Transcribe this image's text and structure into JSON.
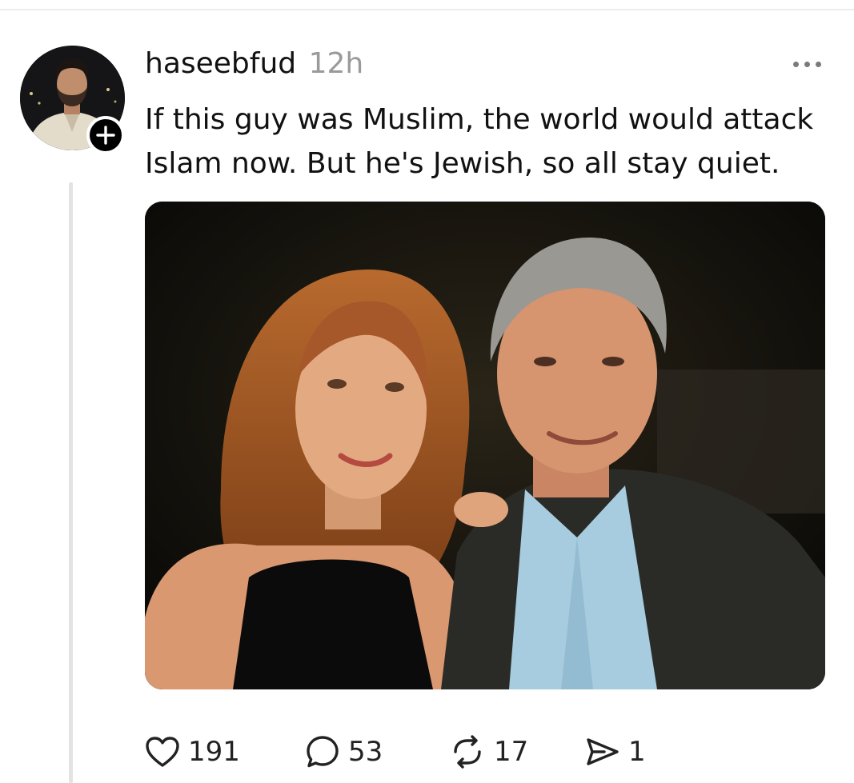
{
  "post": {
    "username": "haseebfud",
    "timestamp": "12h",
    "text": "If this guy was Muslim, the world would attack Islam now. But he's Jewish, so all stay quiet.",
    "avatar_icon": "profile-photo",
    "follow_icon": "plus-icon",
    "more_icon": "ellipsis-icon",
    "image_icon": "attached-photo"
  },
  "actions": {
    "like_count": "191",
    "reply_count": "53",
    "repost_count": "17",
    "share_count": "1",
    "like_icon": "heart-icon",
    "reply_icon": "speech-bubble-icon",
    "repost_icon": "repost-icon",
    "share_icon": "send-icon"
  },
  "colors": {
    "text": "#111111",
    "secondary_text": "#9a9a9a",
    "thread_line": "#e3e3e3",
    "badge": "#000000"
  }
}
